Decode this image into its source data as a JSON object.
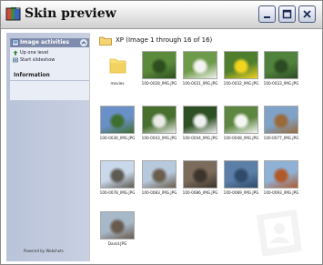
{
  "window": {
    "title": "Skin preview",
    "controls": [
      "minimize-icon",
      "maximize-icon",
      "close-icon"
    ]
  },
  "sidebar": {
    "tasks_panel": {
      "title": "Image activities",
      "items": [
        {
          "label": "Up one level",
          "icon": "up-arrow-icon"
        },
        {
          "label": "Start slideshow",
          "icon": "slideshow-icon"
        }
      ]
    },
    "info_panel": {
      "title": "Information"
    },
    "footer": "Powered by Webshots"
  },
  "content": {
    "header": "XP  (Image 1 through 16 of 16)",
    "items": [
      {
        "caption": "movies",
        "kind": "folder",
        "colors": [
          "#f7df7a",
          "#e6b93a"
        ]
      },
      {
        "caption": "100-0028_IMG.JPG",
        "kind": "image",
        "colors": [
          "#5b8a3a",
          "#2d4f1f"
        ]
      },
      {
        "caption": "100-0031_IMG.JPG",
        "kind": "image",
        "colors": [
          "#6e9b4a",
          "#f2f2f0"
        ]
      },
      {
        "caption": "100-0032_IMG.JPG",
        "kind": "image",
        "colors": [
          "#4f7e2c",
          "#f0d420"
        ]
      },
      {
        "caption": "100-0033_IMG.JPG",
        "kind": "image",
        "colors": [
          "#51823b",
          "#2b4b23"
        ]
      },
      {
        "caption": "100-0036_IMG.JPG",
        "kind": "image",
        "colors": [
          "#6a90c8",
          "#3f6f2e"
        ]
      },
      {
        "caption": "100-0043_IMG.JPG",
        "kind": "image",
        "colors": [
          "#476f2e",
          "#e9e9e6"
        ]
      },
      {
        "caption": "100-0044_IMG.JPG",
        "kind": "image",
        "colors": [
          "#2f4f24",
          "#eef0ef"
        ]
      },
      {
        "caption": "100-0048_IMG.JPG",
        "kind": "image",
        "colors": [
          "#5d8640",
          "#f4f6f4"
        ]
      },
      {
        "caption": "100-0077_IMG.JPG",
        "kind": "image",
        "colors": [
          "#7fa3c8",
          "#9a6a3a"
        ]
      },
      {
        "caption": "100-0078_IMG.JPG",
        "kind": "image",
        "colors": [
          "#c9d8ea",
          "#5d5a52"
        ]
      },
      {
        "caption": "100-0083_IMG.JPG",
        "kind": "image",
        "colors": [
          "#b7c9dd",
          "#6b5e4c"
        ]
      },
      {
        "caption": "100-0086_IMG.JPG",
        "kind": "image",
        "colors": [
          "#7a6b5a",
          "#3d342c"
        ]
      },
      {
        "caption": "100-0089_IMG.JPG",
        "kind": "image",
        "colors": [
          "#5c7fa8",
          "#2f4a6b"
        ]
      },
      {
        "caption": "100-0093_IMG.JPG",
        "kind": "image",
        "colors": [
          "#8fb1d6",
          "#b05a2a"
        ]
      },
      {
        "caption": "David.JPG",
        "kind": "image",
        "colors": [
          "#a7b9c9",
          "#6a5a4d"
        ]
      }
    ]
  }
}
